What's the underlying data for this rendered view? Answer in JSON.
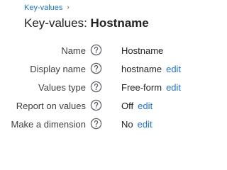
{
  "breadcrumb": {
    "parent": "Key-values",
    "separator": "›"
  },
  "header": {
    "title_prefix": "Key-values: ",
    "title_name": "Hostname"
  },
  "icons": {
    "help": "help-circle-icon"
  },
  "colors": {
    "link": "#1a73e8",
    "text": "#202124",
    "label": "#3c4043",
    "icon": "#5f6368"
  },
  "fields": [
    {
      "label": "Name",
      "value": "Hostname",
      "edit": ""
    },
    {
      "label": "Display name",
      "value": "hostname",
      "edit": "edit"
    },
    {
      "label": "Values type",
      "value": "Free-form",
      "edit": "edit"
    },
    {
      "label": "Report on values",
      "value": "Off",
      "edit": "edit"
    },
    {
      "label": "Make a dimension",
      "value": "No",
      "edit": "edit"
    }
  ]
}
